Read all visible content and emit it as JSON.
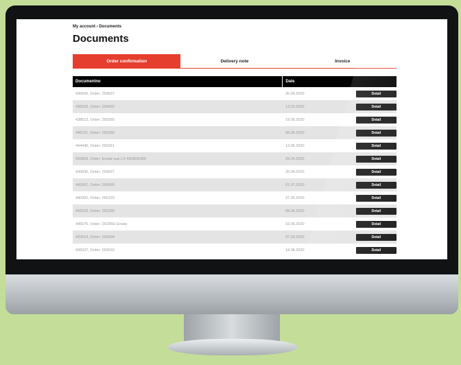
{
  "breadcrumb": "My account › Documents",
  "page_title": "Documents",
  "tabs": [
    {
      "label": "Order confirmation",
      "active": true
    },
    {
      "label": "Delivery note",
      "active": false
    },
    {
      "label": "Invoice",
      "active": false
    }
  ],
  "table": {
    "headers": {
      "document": "Documentno",
      "date": "Date"
    },
    "detail_label": "Detail",
    "rows": [
      {
        "document": "430606, Order: 259637",
        "date": "20.04.2020"
      },
      {
        "document": "436533, Order: 259432",
        "date": "13.03.2020"
      },
      {
        "document": "438512, Order: 260355",
        "date": "19.05.2020"
      },
      {
        "document": "445231, Order: 262066",
        "date": "08.06.2020"
      },
      {
        "document": "444440, Order: 260331",
        "date": "12.06.2020"
      },
      {
        "document": "433828, Order: Ersatz aus LS 430805/300",
        "date": "29.04.2020"
      },
      {
        "document": "430606, Order: 259637",
        "date": "20.04.2020"
      },
      {
        "document": "449361, Order: 260599",
        "date": "01.07.2020"
      },
      {
        "document": "440392, Order: 260133",
        "date": "27.05.2020"
      },
      {
        "document": "443233, Order: 262266",
        "date": "08.06.2020"
      },
      {
        "document": "445076, Order: 262066/ Ersatz",
        "date": "16.06.2020"
      },
      {
        "document": "420514, Order: 259094",
        "date": "07.03.2020"
      },
      {
        "document": "436037, Order: 259532",
        "date": "18.08.2020"
      }
    ]
  },
  "colors": {
    "accent": "#e53e2f",
    "header_bg": "#000000",
    "page_bg": "#c4dd98"
  }
}
